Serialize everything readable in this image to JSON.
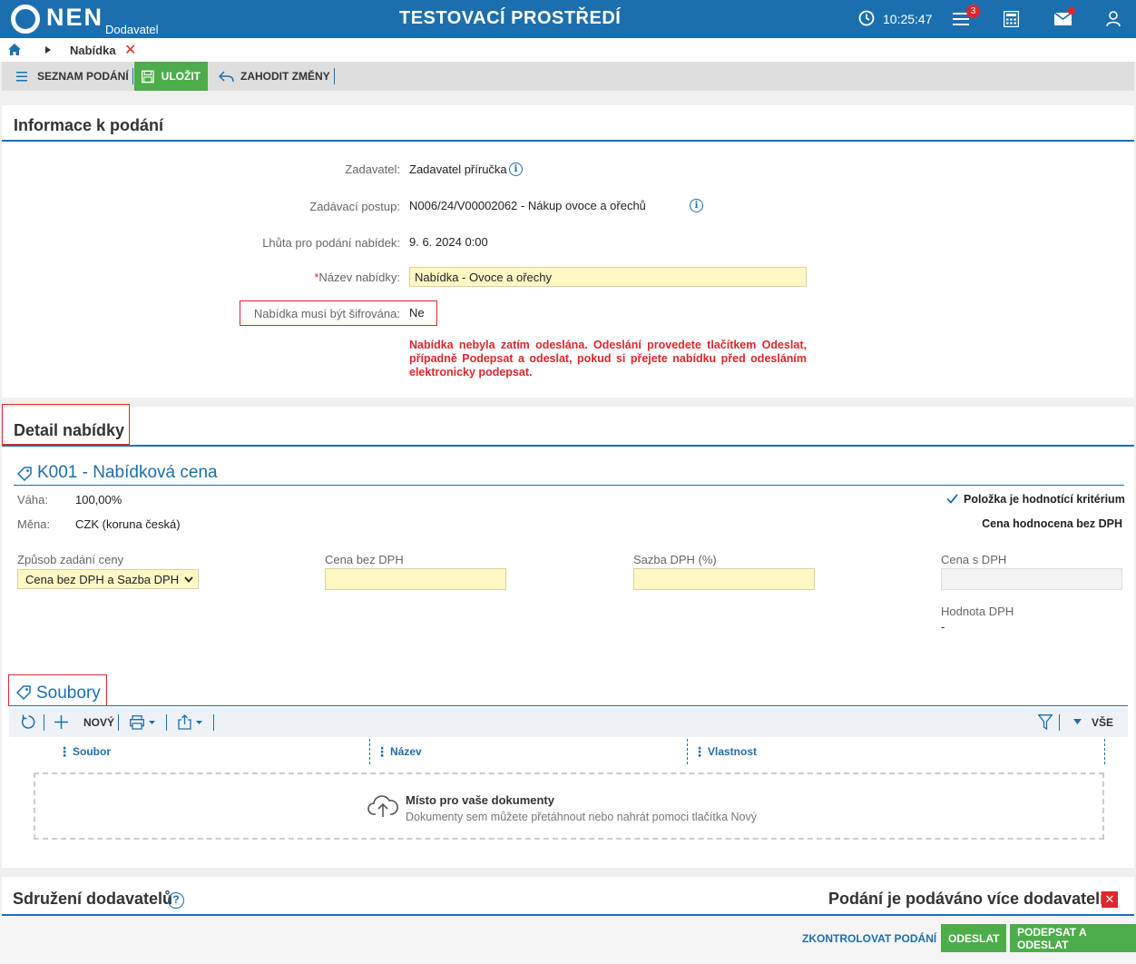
{
  "header": {
    "logo": "NEN",
    "logo_sub": "Dodavatel",
    "env_title": "TESTOVACÍ PROSTŘEDÍ",
    "time": "10:25:47",
    "notif_count": "3",
    "icons": [
      "clock-icon",
      "menu-icon",
      "calculator-icon",
      "mail-icon",
      "user-icon"
    ]
  },
  "breadcrumb": {
    "current": "Nabídka",
    "close": "✕"
  },
  "toolbar": {
    "list": "SEZNAM PODÁNÍ",
    "save": "ULOŽIT",
    "discard": "ZAHODIT ZMĚNY"
  },
  "info": {
    "title": "Informace k podání",
    "contracting_label": "Zadavatel:",
    "contracting_value": "Zadavatel příručka",
    "procedure_label": "Zadávací postup:",
    "procedure_value": "N006/24/V00002062 - Nákup ovoce a ořechů",
    "deadline_label": "Lhůta pro podání nabídek:",
    "deadline_value": "9. 6. 2024 0:00",
    "name_required": "*",
    "name_label": "Název nabídky:",
    "name_value": "Nabídka - Ovoce a ořechy",
    "encrypt_label": "Nabídka musí být šifrována:",
    "encrypt_value": "Ne",
    "warning": "Nabídka nebyla zatím odeslána. Odeslání provedete tlačítkem Odeslat, případně Podepsat a odeslat, pokud si přejete nabídku před odesláním elektronicky podepsat."
  },
  "detail": {
    "title": "Detail nabídky",
    "criterion_title": "K001 - Nabídková cena",
    "weight_label": "Váha:",
    "weight_value": "100,00%",
    "currency_label": "Měna:",
    "currency_value": "CZK (koruna česká)",
    "criterion_flag": "Položka je hodnotící kritérium",
    "price_basis": "Cena hodnocena bez DPH",
    "price_mode_label": "Způsob zadání ceny",
    "price_mode_value": "Cena bez DPH a Sazba DPH",
    "price_no_vat_label": "Cena bez DPH",
    "vat_rate_label": "Sazba DPH (%)",
    "price_vat_label": "Cena s DPH",
    "vat_value_label": "Hodnota DPH",
    "vat_value": "-"
  },
  "files": {
    "title": "Soubory",
    "new_label": "NOVÝ",
    "all_label": "VŠE",
    "col_file": "Soubor",
    "col_name": "Název",
    "col_property": "Vlastnost",
    "drop_title": "Místo pro vaše dokumenty",
    "drop_hint": "Dokumenty sem můžete přetáhnout nebo nahrát pomoci tlačítka Nový"
  },
  "assoc": {
    "title": "Sdružení dodavatelů",
    "multi_label": "Podání je podáváno více dodavateli:"
  },
  "footer": {
    "check": "ZKONTROLOVAT PODÁNÍ",
    "send": "ODESLAT",
    "sign_send": "PODEPSAT A ODESLAT"
  },
  "colors": {
    "primary": "#1c6fae",
    "green": "#4cad4a",
    "red": "#e0262b",
    "yellow_input": "#fff8c4"
  }
}
